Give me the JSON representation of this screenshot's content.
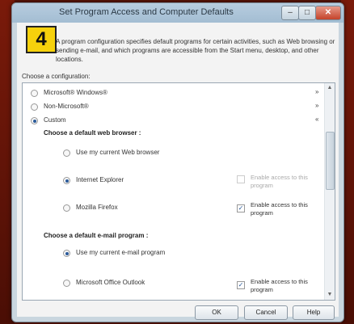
{
  "window": {
    "title": "Set Program Access and Computer Defaults",
    "controls": {
      "minimize": "–",
      "maximize": "□",
      "close": "✕"
    }
  },
  "step_badge": "4",
  "description": "A program configuration specifies default programs for certain activities, such as Web browsing or sending e-mail, and which programs are accessible from the Start menu, desktop, and other locations.",
  "choose_label": "Choose a configuration:",
  "configurations": [
    {
      "label": "Microsoft® Windows®",
      "selected": false,
      "chevron": "»"
    },
    {
      "label": "Non-Microsoft®",
      "selected": false,
      "chevron": "»"
    },
    {
      "label": "Custom",
      "selected": true,
      "chevron": "«"
    }
  ],
  "browser_section": {
    "heading": "Choose a default web browser :",
    "options": [
      {
        "label": "Use my current Web browser",
        "selected": false
      },
      {
        "label": "Internet Explorer",
        "selected": true,
        "access_label": "Enable access to this program",
        "access_checked": false,
        "access_disabled": true
      },
      {
        "label": "Mozilla Firefox",
        "selected": false,
        "access_label": "Enable access to this program",
        "access_checked": true,
        "access_disabled": false
      }
    ]
  },
  "email_section": {
    "heading": "Choose a default e-mail program :",
    "options": [
      {
        "label": "Use my current e-mail program",
        "selected": true
      },
      {
        "label": "Microsoft Office Outlook",
        "selected": false,
        "access_label": "Enable access to this program",
        "access_checked": true,
        "access_disabled": false
      }
    ]
  },
  "scrollbar": {
    "up": "▲",
    "down": "▼"
  },
  "buttons": {
    "ok": "OK",
    "cancel": "Cancel",
    "help": "Help"
  }
}
